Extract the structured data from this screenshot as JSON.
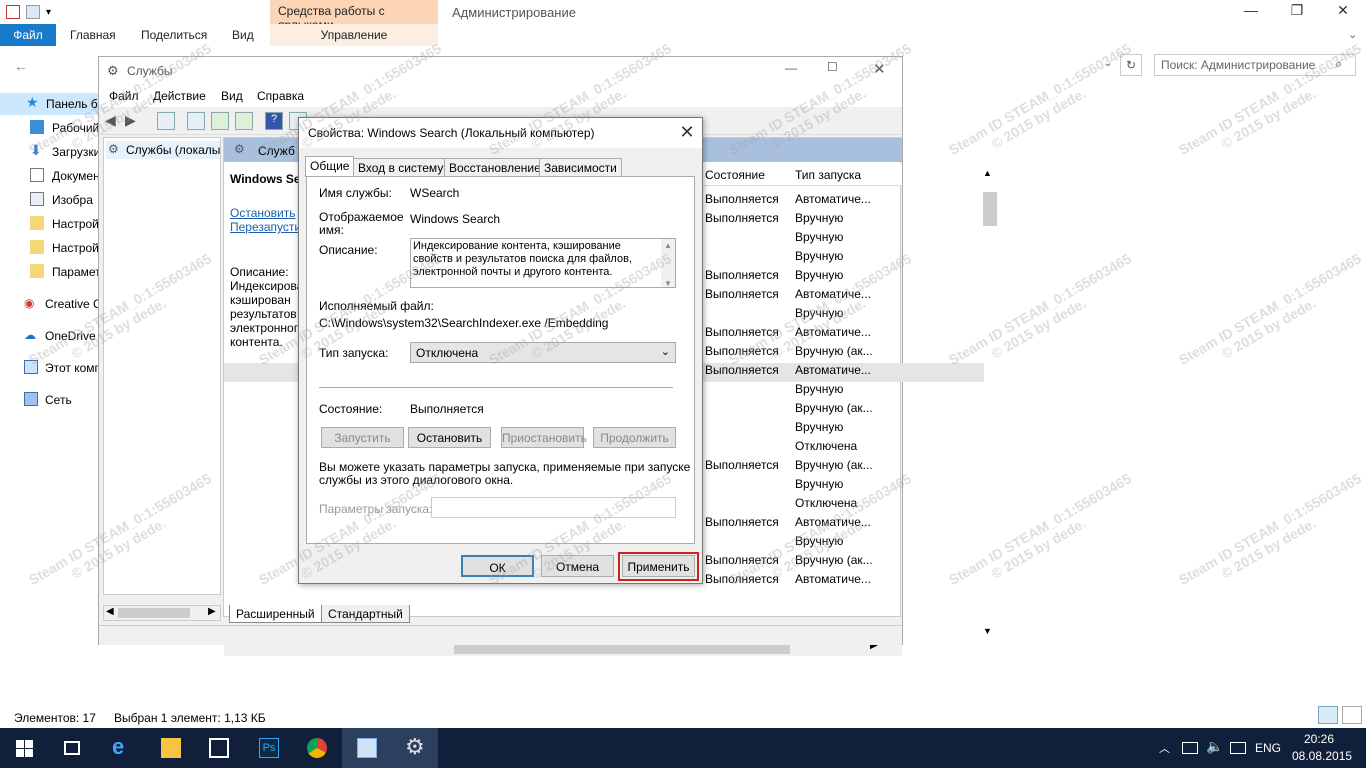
{
  "ribbon": {
    "tools_header": "Средства работы с ярлыками",
    "tools_sub": "Управление",
    "window_title": "Администрирование",
    "tabs": [
      "Файл",
      "Главная",
      "Поделиться",
      "Вид"
    ]
  },
  "search": {
    "placeholder": "Поиск: Администрирование"
  },
  "nav": {
    "items": [
      "Панель б",
      "Рабочий",
      "Загрузки",
      "Докумен",
      "Изобра",
      "Настрой",
      "Настрой",
      "Парамет",
      "Creative C",
      "OneDrive",
      "Этот комп",
      "Сеть"
    ]
  },
  "status": {
    "count": "Элементов: 17",
    "selected": "Выбран 1 элемент: 1,13 КБ"
  },
  "services_window": {
    "title": "Службы",
    "menu": [
      "Файл",
      "Действие",
      "Вид",
      "Справка"
    ],
    "tree_label": "Службы (локалы",
    "header_label": "Служб",
    "service_name": "Windows Search",
    "link_stop": "Остановить",
    "link_restart": "Перезапусти",
    "desc_label": "Описание:",
    "desc_lines": [
      "Индексирова",
      "кэширован",
      "результатов",
      "электронног",
      "контента."
    ],
    "columns": {
      "state": "Состояние",
      "startup": "Тип запуска"
    },
    "rows": [
      {
        "state": "Выполняется",
        "startup": "Автоматиче..."
      },
      {
        "state": "Выполняется",
        "startup": "Вручную"
      },
      {
        "state": "",
        "startup": "Вручную"
      },
      {
        "state": "",
        "startup": "Вручную"
      },
      {
        "state": "Выполняется",
        "startup": "Вручную"
      },
      {
        "state": "Выполняется",
        "startup": "Автоматиче..."
      },
      {
        "state": "",
        "startup": "Вручную"
      },
      {
        "state": "Выполняется",
        "startup": "Автоматиче..."
      },
      {
        "state": "Выполняется",
        "startup": "Вручную (ак..."
      },
      {
        "state": "Выполняется",
        "startup": "Автоматиче..."
      },
      {
        "state": "",
        "startup": "Вручную"
      },
      {
        "state": "",
        "startup": "Вручную (ак..."
      },
      {
        "state": "",
        "startup": "Вручную"
      },
      {
        "state": "",
        "startup": "Отключена"
      },
      {
        "state": "Выполняется",
        "startup": "Вручную (ак..."
      },
      {
        "state": "",
        "startup": "Вручную"
      },
      {
        "state": "",
        "startup": "Отключена"
      },
      {
        "state": "Выполняется",
        "startup": "Автоматиче..."
      },
      {
        "state": "",
        "startup": "Вручную"
      },
      {
        "state": "Выполняется",
        "startup": "Вручную (ак..."
      },
      {
        "state": "Выполняется",
        "startup": "Автоматиче..."
      }
    ],
    "view_tabs": [
      "Расширенный",
      "Стандартный"
    ]
  },
  "dialog": {
    "title": "Свойства: Windows Search (Локальный компьютер)",
    "tabs": [
      "Общие",
      "Вход в систему",
      "Восстановление",
      "Зависимости"
    ],
    "service_name_label": "Имя службы:",
    "service_name_value": "WSearch",
    "display_name_label_1": "Отображаемое",
    "display_name_label_2": "имя:",
    "display_name_value": "Windows Search",
    "description_label": "Описание:",
    "description_lines": [
      "Индексирование контента, кэширование",
      "свойств и результатов поиска для файлов,",
      "электронной почты и другого контента."
    ],
    "exe_label": "Исполняемый файл:",
    "exe_value": "C:\\Windows\\system32\\SearchIndexer.exe /Embedding",
    "startup_label": "Тип запуска:",
    "startup_value": "Отключена",
    "state_label": "Состояние:",
    "state_value": "Выполняется",
    "btn_start": "Запустить",
    "btn_stop": "Остановить",
    "btn_pause": "Приостановить",
    "btn_resume": "Продолжить",
    "hint_line1": "Вы можете указать параметры запуска, применяемые при запуске",
    "hint_line2": "службы из этого диалогового окна.",
    "params_label": "Параметры запуска:",
    "btn_ok": "ОК",
    "btn_cancel": "Отмена",
    "btn_apply": "Применить"
  },
  "taskbar": {
    "lang": "ENG",
    "time": "20:26",
    "date": "08.08.2015"
  },
  "watermark": {
    "line1": "Steam ID STEAM_0:1:55603465",
    "line2": "© 2015 by dede."
  }
}
